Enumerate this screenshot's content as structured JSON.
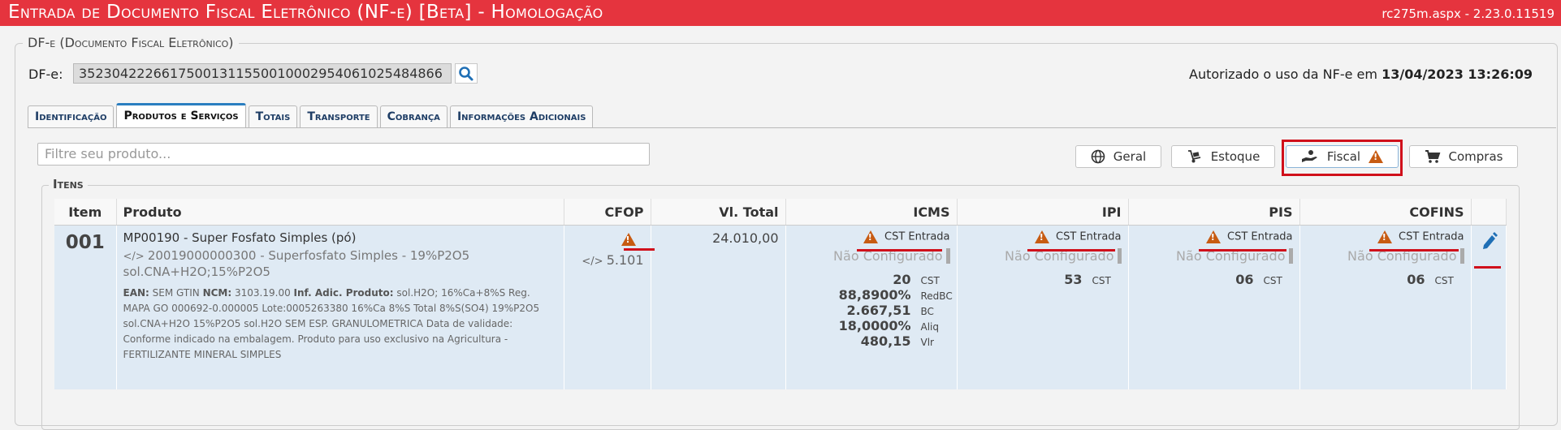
{
  "window": {
    "title": "Entrada de Documento Fiscal Eletrônico (NF-e) [Beta]  - Homologação",
    "version": "rc275m.aspx - 2.23.0.11519"
  },
  "header": {
    "panel_legend": "DF-e (Documento Fiscal Eletrônico)",
    "dfe_label": "DF-e:",
    "dfe_value": "35230422266175001311550010002954061025484866",
    "auth_text": "Autorizado o uso da NF-e em",
    "auth_datetime": "13/04/2023 13:26:09"
  },
  "tabs": [
    {
      "label": "Identificação",
      "active": false
    },
    {
      "label": "Produtos e Serviços",
      "active": true
    },
    {
      "label": "Totais",
      "active": false
    },
    {
      "label": "Transporte",
      "active": false
    },
    {
      "label": "Cobrança",
      "active": false
    },
    {
      "label": "Informações Adicionais",
      "active": false
    }
  ],
  "toolbar": {
    "filter_placeholder": "Filtre seu produto...",
    "geral_label": "Geral",
    "estoque_label": "Estoque",
    "fiscal_label": "Fiscal",
    "compras_label": "Compras"
  },
  "items": {
    "legend": "Itens",
    "columns": {
      "item": "Item",
      "produto": "Produto",
      "cfop": "CFOP",
      "vltotal": "Vl. Total",
      "icms": "ICMS",
      "ipi": "IPI",
      "pis": "PIS",
      "cofins": "COFINS"
    },
    "row": {
      "item": "001",
      "produto_title": "MP00190 - Super Fosfato Simples (pó)",
      "produto_code": "20019000000300 - Superfosfato Simples - 19%P2O5 sol.CNA+H2O;15%P2O5",
      "ean_label": "EAN:",
      "ean": "SEM GTIN",
      "ncm_label": "NCM:",
      "ncm": "3103.19.00",
      "inf_label": "Inf. Adic. Produto:",
      "inf": "sol.H2O; 16%Ca+8%S Reg. MAPA GO 000692-0.000005 Lote:0005263380 16%Ca 8%S Total 8%S(SO4) 19%P2O5 sol.CNA+H2O 15%P2O5 sol.H2O SEM ESP. GRANULOMETRICA Data de validade: Conforme indicado na embalagem. Produto para uso exclusivo na Agricultura - FERTILIZANTE MINERAL SIMPLES",
      "cfop": "5.101",
      "vltotal": "24.010,00",
      "cst_entrada": "CST Entrada",
      "nao_configurado": "Não Configurado",
      "icms": {
        "cst": "20",
        "cst_l": "CST",
        "redbc": "88,8900%",
        "redbc_l": "RedBC",
        "bc": "2.667,51",
        "bc_l": "BC",
        "aliq": "18,0000%",
        "aliq_l": "Aliq",
        "vlr": "480,15",
        "vlr_l": "Vlr"
      },
      "ipi": {
        "cst": "53",
        "cst_l": "CST"
      },
      "pis": {
        "cst": "06",
        "cst_l": "CST"
      },
      "cofins": {
        "cst": "06",
        "cst_l": "CST"
      }
    }
  },
  "colors": {
    "title_bar": "#e5343e",
    "warning": "#c75b12",
    "highlight": "#d0101b",
    "row_bg": "#dfeaf4",
    "accent_blue": "#2a7ec0"
  },
  "icons": [
    "search-icon",
    "globe-icon",
    "dolly-icon",
    "hand-coin-icon",
    "warning-icon",
    "cart-icon",
    "code-icon",
    "edit-pencil-icon"
  ]
}
